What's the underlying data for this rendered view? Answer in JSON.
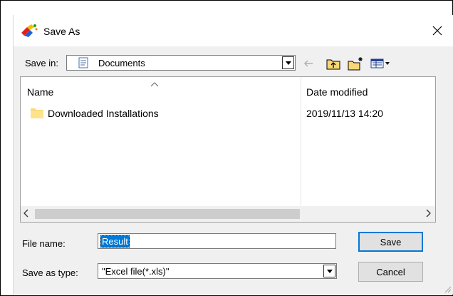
{
  "window": {
    "title": "Save As"
  },
  "toolbar": {
    "save_in_label": "Save in:",
    "save_in_value": "Documents"
  },
  "file_list": {
    "columns": [
      "Name",
      "Date modified"
    ],
    "rows": [
      {
        "name": "Downloaded Installations",
        "date": "2019/11/13 14:20",
        "icon": "folder-icon"
      }
    ]
  },
  "form": {
    "file_name_label": "File name:",
    "file_name_value": "Result",
    "save_type_label": "Save as type:",
    "save_type_value": "\"Excel file(*.xls)\""
  },
  "buttons": {
    "save": "Save",
    "cancel": "Cancel"
  },
  "icons": [
    "app-icon",
    "close-icon",
    "document-icon",
    "dropdown-arrow-icon",
    "back-arrow-icon",
    "up-folder-icon",
    "new-folder-icon",
    "view-menu-icon",
    "sort-caret-icon",
    "folder-icon",
    "scroll-left-icon",
    "scroll-right-icon",
    "resize-grip-icon"
  ],
  "colors": {
    "selection": "#0078d7",
    "dialog_bg": "#f0f0f0",
    "folder": "#f8d775"
  }
}
